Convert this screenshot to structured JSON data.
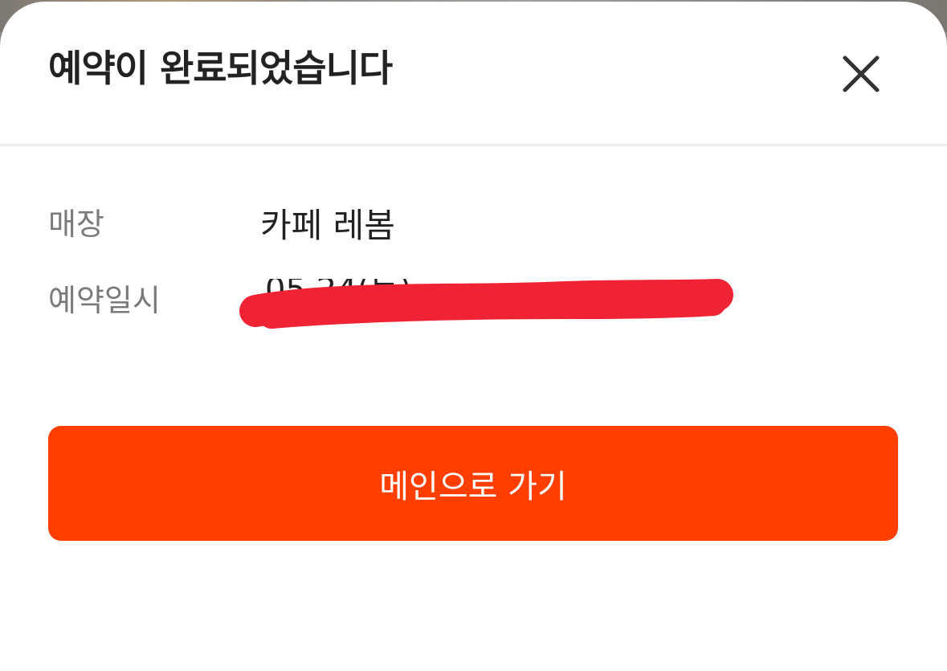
{
  "dialog": {
    "title": "예약이 완료되었습니다",
    "close_icon": "close-icon"
  },
  "details": {
    "store_label": "매장",
    "store_value": "카페 레봄",
    "datetime_label": "예약일시",
    "datetime_value": "05.24(토)",
    "datetime_redacted": true
  },
  "actions": {
    "main_button_label": "메인으로 가기"
  },
  "colors": {
    "accent": "#ff3e00",
    "redaction": "#f02335",
    "title_text": "#222222",
    "label_text": "#7a7a7a"
  }
}
